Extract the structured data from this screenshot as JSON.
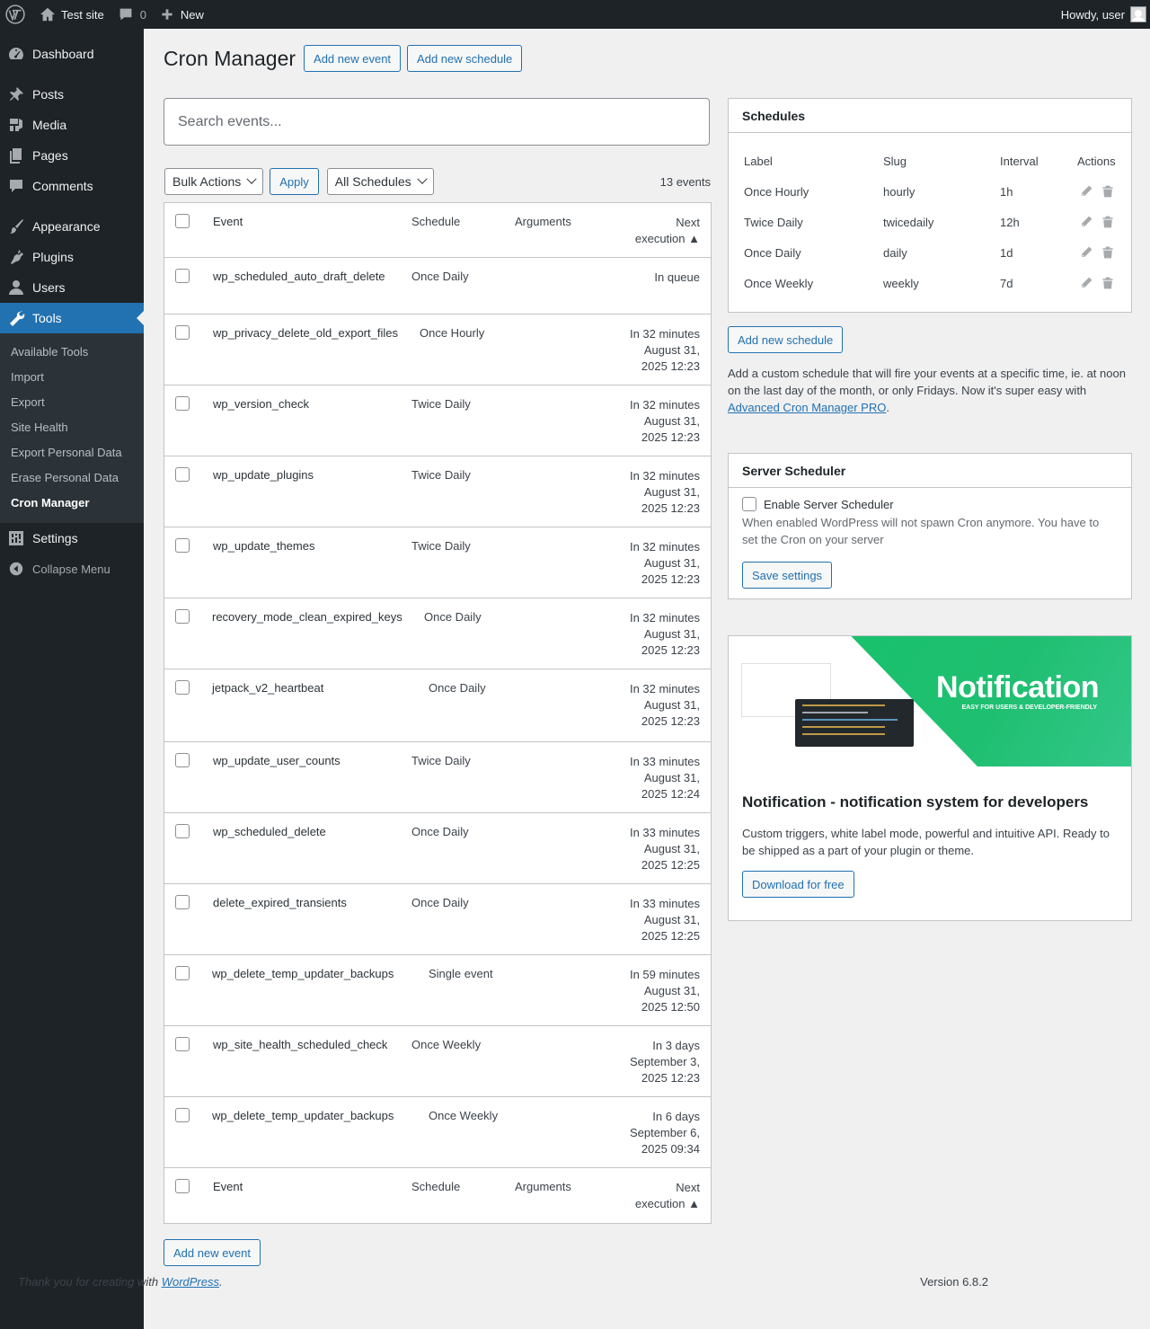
{
  "adminbar": {
    "site_name": "Test site",
    "comments_count": "0",
    "new_label": "New",
    "howdy": "Howdy, user"
  },
  "menu": {
    "items": [
      {
        "label": "Dashboard",
        "icon": "dashboard-icon"
      },
      {
        "label": "Posts",
        "icon": "pin-icon"
      },
      {
        "label": "Media",
        "icon": "media-icon"
      },
      {
        "label": "Pages",
        "icon": "pages-icon"
      },
      {
        "label": "Comments",
        "icon": "comment-icon"
      },
      {
        "label": "Appearance",
        "icon": "brush-icon"
      },
      {
        "label": "Plugins",
        "icon": "plugin-icon"
      },
      {
        "label": "Users",
        "icon": "user-icon"
      },
      {
        "label": "Tools",
        "icon": "wrench-icon"
      },
      {
        "label": "Settings",
        "icon": "sliders-icon"
      },
      {
        "label": "Collapse Menu",
        "icon": "collapse-icon"
      }
    ],
    "tools_submenu": [
      "Available Tools",
      "Import",
      "Export",
      "Site Health",
      "Export Personal Data",
      "Erase Personal Data",
      "Cron Manager"
    ]
  },
  "page": {
    "title": "Cron Manager",
    "add_event": "Add new event",
    "add_schedule": "Add new schedule",
    "search_placeholder": "Search events...",
    "bulk_actions": "Bulk Actions",
    "apply": "Apply",
    "all_schedules": "All Schedules",
    "events_count": "13 events",
    "bottom_add_event": "Add new event"
  },
  "table": {
    "headers": {
      "event": "Event",
      "schedule": "Schedule",
      "arguments": "Arguments",
      "next_line1": "Next",
      "next_line2": "execution ▲"
    },
    "rows": [
      {
        "event": "wp_scheduled_auto_draft_delete",
        "schedule": "Once Daily",
        "next": [
          "In queue"
        ]
      },
      {
        "event": "wp_privacy_delete_old_export_files",
        "schedule": "Once Hourly",
        "next": [
          "In 32 minutes",
          "August 31,",
          "2025 12:23"
        ]
      },
      {
        "event": "wp_version_check",
        "schedule": "Twice Daily",
        "next": [
          "In 32 minutes",
          "August 31,",
          "2025 12:23"
        ]
      },
      {
        "event": "wp_update_plugins",
        "schedule": "Twice Daily",
        "next": [
          "In 32 minutes",
          "August 31,",
          "2025 12:23"
        ]
      },
      {
        "event": "wp_update_themes",
        "schedule": "Twice Daily",
        "next": [
          "In 32 minutes",
          "August 31,",
          "2025 12:23"
        ]
      },
      {
        "event": "recovery_mode_clean_expired_keys",
        "schedule": "Once Daily",
        "next": [
          "In 32 minutes",
          "August 31,",
          "2025 12:23"
        ]
      },
      {
        "event": "jetpack_v2_heartbeat",
        "schedule": "Once Daily",
        "next": [
          "In 32 minutes",
          "August 31,",
          "2025 12:23"
        ]
      },
      {
        "event": "wp_update_user_counts",
        "schedule": "Twice Daily",
        "next": [
          "In 33 minutes",
          "August 31,",
          "2025 12:24"
        ]
      },
      {
        "event": "wp_scheduled_delete",
        "schedule": "Once Daily",
        "next": [
          "In 33 minutes",
          "August 31,",
          "2025 12:25"
        ]
      },
      {
        "event": "delete_expired_transients",
        "schedule": "Once Daily",
        "next": [
          "In 33 minutes",
          "August 31,",
          "2025 12:25"
        ]
      },
      {
        "event": "wp_delete_temp_updater_backups",
        "schedule": "Single event",
        "next": [
          "In 59 minutes",
          "August 31,",
          "2025 12:50"
        ]
      },
      {
        "event": "wp_site_health_scheduled_check",
        "schedule": "Once Weekly",
        "next": [
          "In 3 days",
          "September 3,",
          "2025 12:23"
        ]
      },
      {
        "event": "wp_delete_temp_updater_backups",
        "schedule": "Once Weekly",
        "next": [
          "In 6 days",
          "September 6,",
          "2025 09:34"
        ]
      }
    ]
  },
  "schedules": {
    "title": "Schedules",
    "headers": {
      "label": "Label",
      "slug": "Slug",
      "interval": "Interval",
      "actions": "Actions"
    },
    "rows": [
      {
        "label": "Once Hourly",
        "slug": "hourly",
        "interval": "1h"
      },
      {
        "label": "Twice Daily",
        "slug": "twicedaily",
        "interval": "12h"
      },
      {
        "label": "Once Daily",
        "slug": "daily",
        "interval": "1d"
      },
      {
        "label": "Once Weekly",
        "slug": "weekly",
        "interval": "7d"
      }
    ],
    "add_button": "Add new schedule",
    "promo_text": "Add a custom schedule that will fire your events at a specific time, ie. at noon on the last day of the month, or only Fridays. Now it's super easy with ",
    "promo_link": "Advanced Cron Manager PRO",
    "promo_end": "."
  },
  "server_scheduler": {
    "title": "Server Scheduler",
    "checkbox_label": "Enable Server Scheduler",
    "description": "When enabled WordPress will not spawn Cron anymore. You have to set the Cron on your server",
    "save": "Save settings"
  },
  "notification": {
    "logo": "Notification",
    "tagline": "EASY FOR USERS & DEVELOPER-FRIENDLY",
    "title": "Notification - notification system for developers",
    "description": "Custom triggers, white label mode, powerful and intuitive API. Ready to be shipped as a part of your plugin or theme.",
    "download": "Download for free"
  },
  "footer": {
    "thanks_pre": "Thank you for creating with ",
    "thanks_link": "WordPress",
    "thanks_post": ".",
    "version": "Version 6.8.2"
  }
}
